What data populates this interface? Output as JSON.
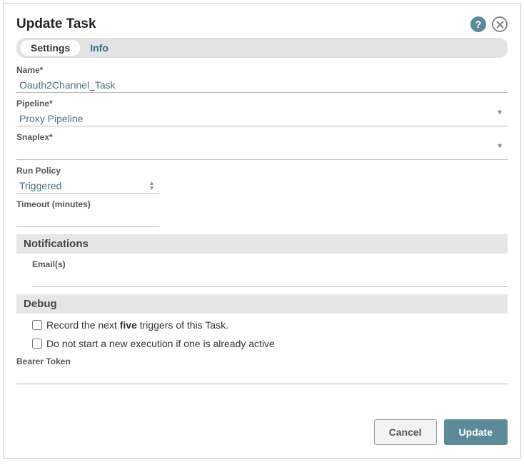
{
  "dialog": {
    "title": "Update Task"
  },
  "tabs": {
    "settings": "Settings",
    "info": "Info"
  },
  "fields": {
    "name_label": "Name*",
    "name_value": "Oauth2Channel_Task",
    "pipeline_label": "Pipeline*",
    "pipeline_value": "Proxy Pipeline",
    "snaplex_label": "Snaplex*",
    "snaplex_value": "",
    "run_policy_label": "Run Policy",
    "run_policy_value": "Triggered",
    "timeout_label": "Timeout (minutes)",
    "timeout_value": "",
    "emails_label": "Email(s)",
    "emails_value": "",
    "bearer_label": "Bearer Token",
    "bearer_value": ""
  },
  "sections": {
    "notifications": "Notifications",
    "debug": "Debug"
  },
  "debug": {
    "record_pre": "Record the next ",
    "record_bold": "five",
    "record_post": " triggers of this Task.",
    "no_new_exec": "Do not start a new execution if one is already active"
  },
  "footer": {
    "cancel": "Cancel",
    "update": "Update"
  }
}
